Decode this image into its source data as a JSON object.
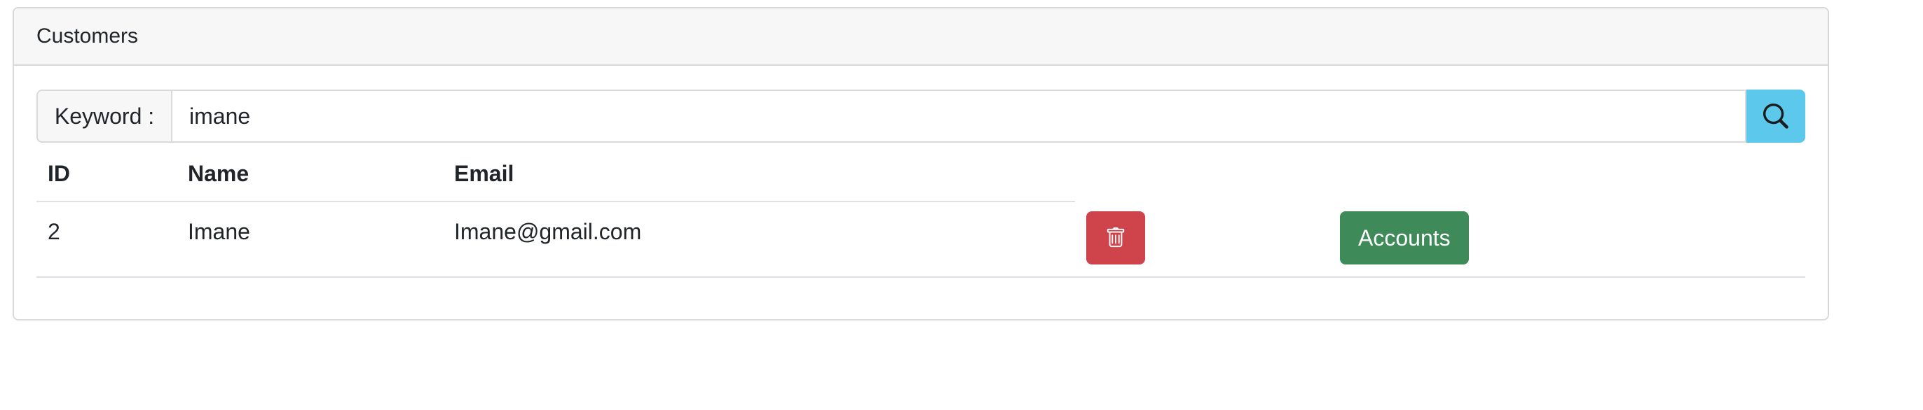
{
  "card": {
    "title": "Customers"
  },
  "search": {
    "label": "Keyword :",
    "value": "imane",
    "button_icon": "search-icon"
  },
  "table": {
    "columns": [
      "ID",
      "Name",
      "Email"
    ],
    "rows": [
      {
        "id": "2",
        "name": "Imane",
        "email": "Imane@gmail.com",
        "delete_icon": "trash-icon",
        "accounts_label": "Accounts"
      }
    ]
  },
  "colors": {
    "search_button": "#5bc8ec",
    "delete_button": "#cf434a",
    "accounts_button": "#3e8a59"
  }
}
